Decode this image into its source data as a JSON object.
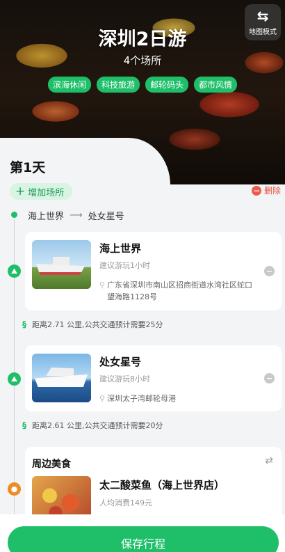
{
  "header": {
    "title": "深圳2日游",
    "subtitle": "4个场所",
    "tags": [
      "滨海休闲",
      "科技旅游",
      "邮轮码头",
      "都市风情"
    ],
    "map_mode_label": "地图模式",
    "map_mode_icon": "swap-route-icon"
  },
  "day": {
    "label": "第1天",
    "add_place_label": "增加场所",
    "delete_label": "删除",
    "route": {
      "from": "海上世界",
      "to": "处女星号"
    }
  },
  "places": [
    {
      "name": "海上世界",
      "suggestion": "建议游玩1小时",
      "address": "广东省深圳市南山区招商街道水湾社区蛇口望海路1128号"
    },
    {
      "name": "处女星号",
      "suggestion": "建议游玩8小时",
      "address": "深圳太子湾邮轮母港"
    }
  ],
  "distances": [
    "距离2.71 公里,公共交通预计需要25分",
    "距离2.61 公里,公共交通预计需要20分"
  ],
  "food": {
    "section_title": "周边美食",
    "name": "太二酸菜鱼（海上世界店）",
    "price": "人均消费149元"
  },
  "footer": {
    "save_label": "保存行程"
  },
  "colors": {
    "accent": "#1fbf6a",
    "danger": "#e4513f",
    "food_marker": "#f08a24"
  }
}
